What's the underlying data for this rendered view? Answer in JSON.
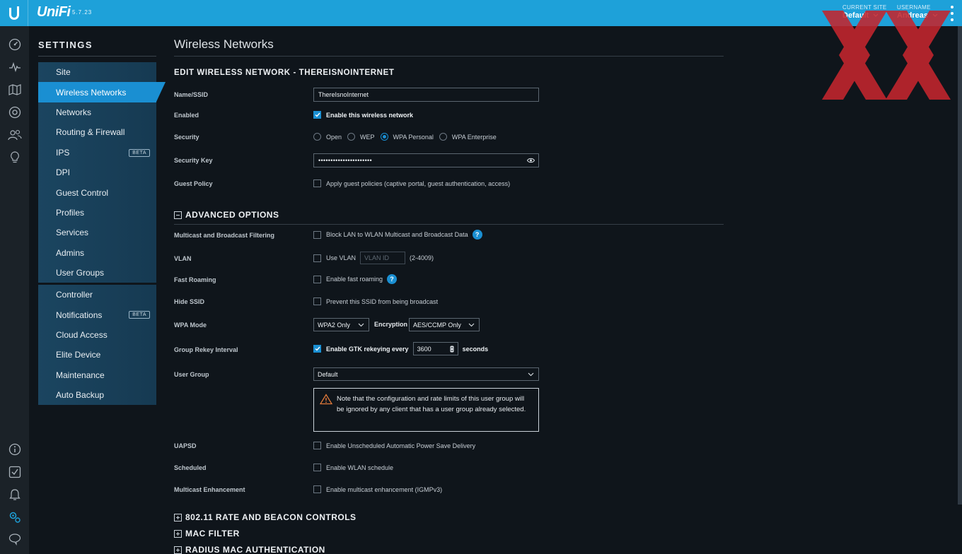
{
  "topbar": {
    "brand": "UniFi",
    "version": "5.7.23",
    "current_site_label": "CURRENT SITE",
    "current_site_value": "Default",
    "username_label": "USERNAME",
    "username_value": "Andreas"
  },
  "rail_icons": {
    "top": [
      "dashboard-icon",
      "statistics-icon",
      "map-icon",
      "devices-icon",
      "clients-icon",
      "insights-icon"
    ],
    "bottom": [
      "info-icon",
      "tasks-icon",
      "alerts-icon",
      "settings-icon",
      "chat-icon"
    ]
  },
  "settings": {
    "title": "SETTINGS",
    "group1": [
      {
        "label": "Site"
      },
      {
        "label": "Wireless Networks",
        "active": true
      },
      {
        "label": "Networks"
      },
      {
        "label": "Routing & Firewall"
      },
      {
        "label": "IPS",
        "badge": "BETA"
      },
      {
        "label": "DPI"
      },
      {
        "label": "Guest Control"
      },
      {
        "label": "Profiles"
      },
      {
        "label": "Services"
      },
      {
        "label": "Admins"
      },
      {
        "label": "User Groups"
      }
    ],
    "group2": [
      {
        "label": "Controller"
      },
      {
        "label": "Notifications",
        "badge": "BETA"
      },
      {
        "label": "Cloud Access"
      },
      {
        "label": "Elite Device"
      },
      {
        "label": "Maintenance"
      },
      {
        "label": "Auto Backup"
      }
    ]
  },
  "main": {
    "page_title": "Wireless Networks",
    "edit_heading": "EDIT WIRELESS NETWORK - THEREISNOINTERNET",
    "name_label": "Name/SSID",
    "name_value": "ThereIsnoInternet",
    "enabled_label": "Enabled",
    "enabled_text": "Enable this wireless network",
    "security_label": "Security",
    "security_options": [
      "Open",
      "WEP",
      "WPA Personal",
      "WPA Enterprise"
    ],
    "security_selected": "WPA Personal",
    "key_label": "Security Key",
    "key_value": "••••••••••••••••••••••",
    "guest_label": "Guest Policy",
    "guest_text": "Apply guest policies (captive portal, guest authentication, access)",
    "advanced_heading": "ADVANCED OPTIONS",
    "multicast_label": "Multicast and Broadcast Filtering",
    "multicast_text": "Block LAN to WLAN Multicast and Broadcast Data",
    "vlan_label": "VLAN",
    "vlan_text": "Use VLAN",
    "vlan_placeholder": "VLAN ID",
    "vlan_range": "(2-4009)",
    "fast_label": "Fast Roaming",
    "fast_text": "Enable fast roaming",
    "hide_label": "Hide SSID",
    "hide_text": "Prevent this SSID from being broadcast",
    "wpa_label": "WPA Mode",
    "wpa_value": "WPA2 Only",
    "encryption_label": "Encryption",
    "encryption_value": "AES/CCMP Only",
    "rekey_label": "Group Rekey Interval",
    "rekey_text": "Enable GTK rekeying every",
    "rekey_value": "3600",
    "rekey_unit": "seconds",
    "usergroup_label": "User Group",
    "usergroup_value": "Default",
    "note_text": "Note that the configuration and rate limits of this user group will be ignored by any client that has a user group already selected.",
    "uapsd_label": "UAPSD",
    "uapsd_text": "Enable Unscheduled Automatic Power Save Delivery",
    "scheduled_label": "Scheduled",
    "scheduled_text": "Enable WLAN schedule",
    "mcast_enh_label": "Multicast Enhancement",
    "mcast_enh_text": "Enable multicast enhancement (IGMPv3)",
    "collapsed_sections": [
      "802.11 RATE AND BEACON CONTROLS",
      "MAC FILTER",
      "RADIUS MAC AUTHENTICATION"
    ]
  },
  "colors": {
    "topbar": "#1ea1d9",
    "accent": "#1a8fd2",
    "background": "#0f151b",
    "watermark": "#c4262e"
  }
}
